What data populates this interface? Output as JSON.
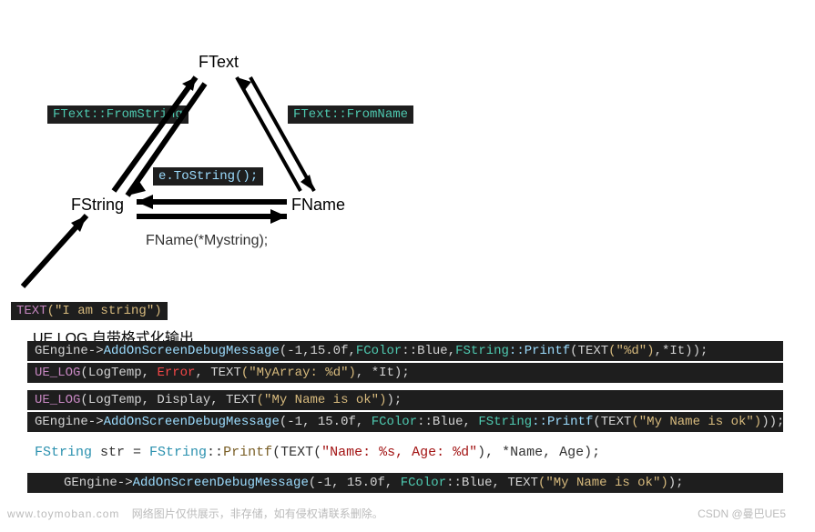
{
  "diagram": {
    "nodes": {
      "ftext": "FText",
      "fstring": "FString",
      "fname": "FName"
    },
    "edges": {
      "ftext_fromstring": "FText::FromString",
      "ftext_fromname": "FText::FromName",
      "tostring": "e.ToString();",
      "fname_ctor": "FName(*Mystring);"
    },
    "literal_line": {
      "macro": "TEXT",
      "str": "(\"I am string\")"
    }
  },
  "section_heading": "UE LOG 自带格式化输出",
  "code": {
    "block1": {
      "line1": {
        "pre": " GEngine->",
        "fn": "AddOnScreenDebugMessage",
        "args_a": "(-1,15.0f,",
        "fclass": "FColor",
        "blue": "::Blue,",
        "fstring": "FString",
        "printf": "::Printf",
        "text_macro": "(TEXT",
        "str": "(\"%d\")",
        "tail": ",*It));"
      },
      "line2": {
        "uelog": "UE_LOG",
        "args_a": "(LogTemp, ",
        "err": "Error",
        "mid": ", TEXT",
        "str": "(\"MyArray: %d\")",
        "tail": ", *It);"
      }
    },
    "block2": {
      "line1": {
        "uelog": "UE_LOG",
        "args_a": "(LogTemp, Display, TEXT",
        "str": "(\"My Name is ok\")",
        "tail": ");"
      },
      "line2": {
        "pre": " GEngine->",
        "fn": "AddOnScreenDebugMessage",
        "args_a": "(-1, 15.0f, ",
        "fclass": "FColor",
        "blue": "::Blue, ",
        "fstring": "FString",
        "printf": "::Printf",
        "text_macro": "(TEXT",
        "str": "(\"My Name is ok\")",
        "tail": "));"
      }
    },
    "light_line": "FString str = FString::Printf(TEXT(\"Name: %s, Age: %d\"), *Name, Age);",
    "block3": {
      "line1": {
        "pre": "GEngine->",
        "fn": "AddOnScreenDebugMessage",
        "args_a": "(-1, 15.0f, ",
        "fclass": "FColor",
        "blue": "::Blue, TEXT",
        "str": "(\"My Name is ok\")",
        "tail": ");"
      }
    }
  },
  "footer": {
    "site": "www.toymoban.com",
    "note": "网络图片仅供展示，非存储，如有侵权请联系删除。",
    "author": "CSDN @曼巴UE5"
  }
}
